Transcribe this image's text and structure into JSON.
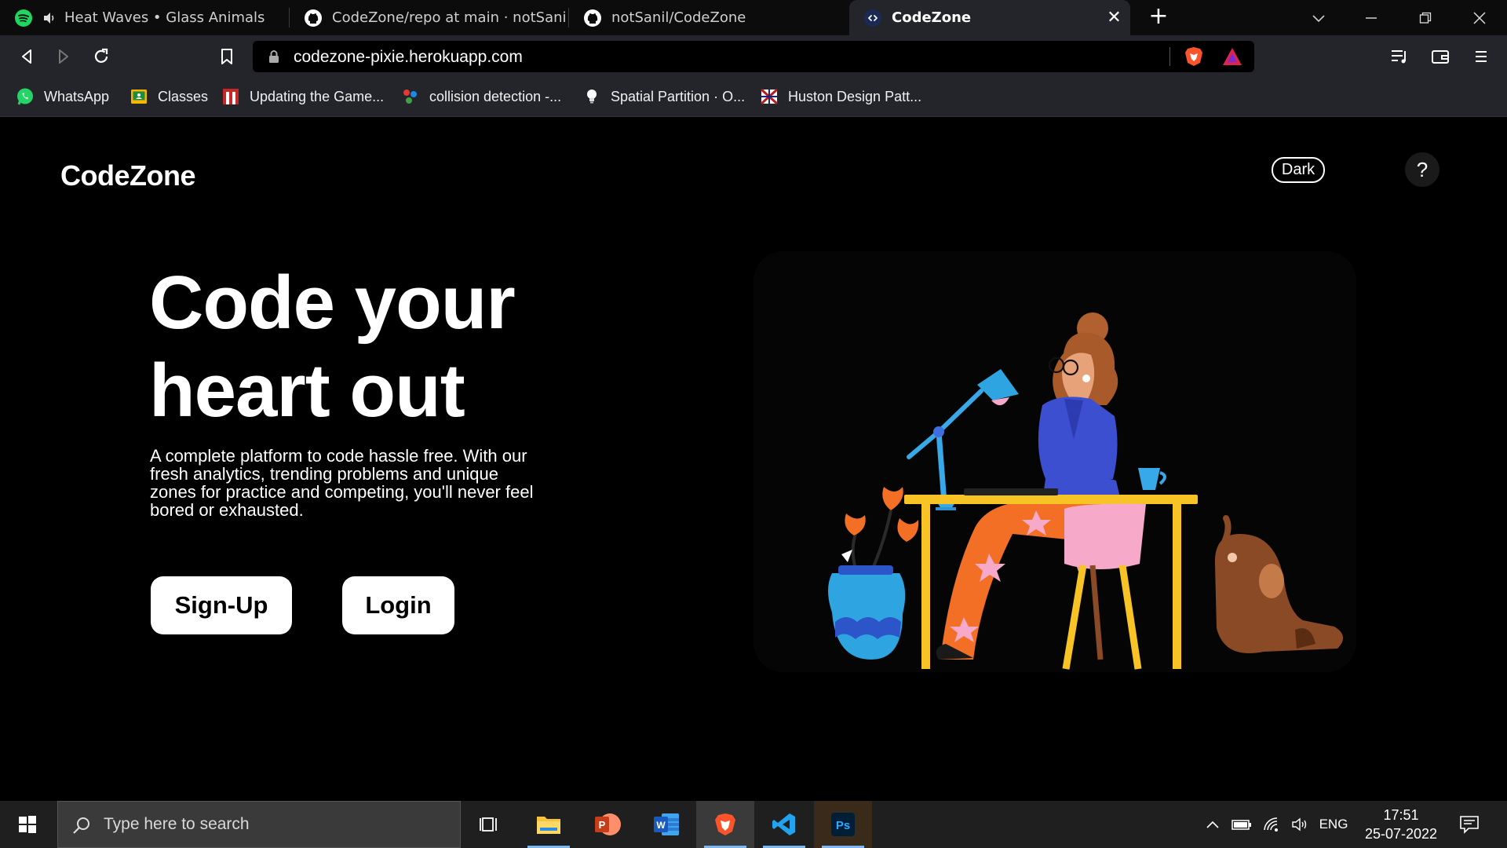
{
  "browser": {
    "tabs": [
      {
        "title": "Heat Waves • Glass Animals",
        "icon": "spotify-icon",
        "audio": true,
        "active": false
      },
      {
        "title": "CodeZone/repo at main · notSanil/CodeZone",
        "icon": "github-icon",
        "active": false
      },
      {
        "title": "notSanil/CodeZone",
        "icon": "github-icon",
        "active": false
      },
      {
        "title": "CodeZone",
        "icon": "codezone-icon",
        "active": true
      }
    ],
    "new_tab_label": "+",
    "close_tab_label": "✕",
    "url": "codezone-pixie.herokuapp.com",
    "bookmarks": [
      {
        "label": "WhatsApp",
        "icon": "whatsapp-icon"
      },
      {
        "label": "Classes",
        "icon": "classroom-icon"
      },
      {
        "label": "Updating the Game...",
        "icon": "bookmark-red-icon"
      },
      {
        "label": "collision detection -...",
        "icon": "bookmark-graph-icon"
      },
      {
        "label": "Spatial Partition · O...",
        "icon": "lightbulb-icon"
      },
      {
        "label": "Huston Design Patt...",
        "icon": "bookmark-flag-icon"
      }
    ]
  },
  "page": {
    "logo": "CodeZone",
    "theme_toggle": "Dark",
    "help_label": "?",
    "hero": {
      "title_line1": "Code your",
      "title_line2": "heart out",
      "description": "A complete platform to code hassle free. With our fresh analytics, trending problems and unique zones for practice and competing, you'll never feel bored or exhausted.",
      "signup_label": "Sign-Up",
      "login_label": "Login"
    }
  },
  "taskbar": {
    "search_placeholder": "Type here to search",
    "apps": [
      "task-view-icon",
      "file-explorer-icon",
      "powerpoint-icon",
      "word-icon",
      "brave-icon",
      "vscode-icon",
      "photoshop-icon"
    ],
    "language": "ENG",
    "time": "17:51",
    "date": "25-07-2022"
  },
  "colors": {
    "page_bg": "#000000",
    "chrome_bg": "#23252a",
    "taskbar_bg": "#1f1f1f",
    "brave_orange": "#fb542b",
    "illustration_yellow": "#f7c325",
    "illustration_blue": "#3d4fd1"
  }
}
